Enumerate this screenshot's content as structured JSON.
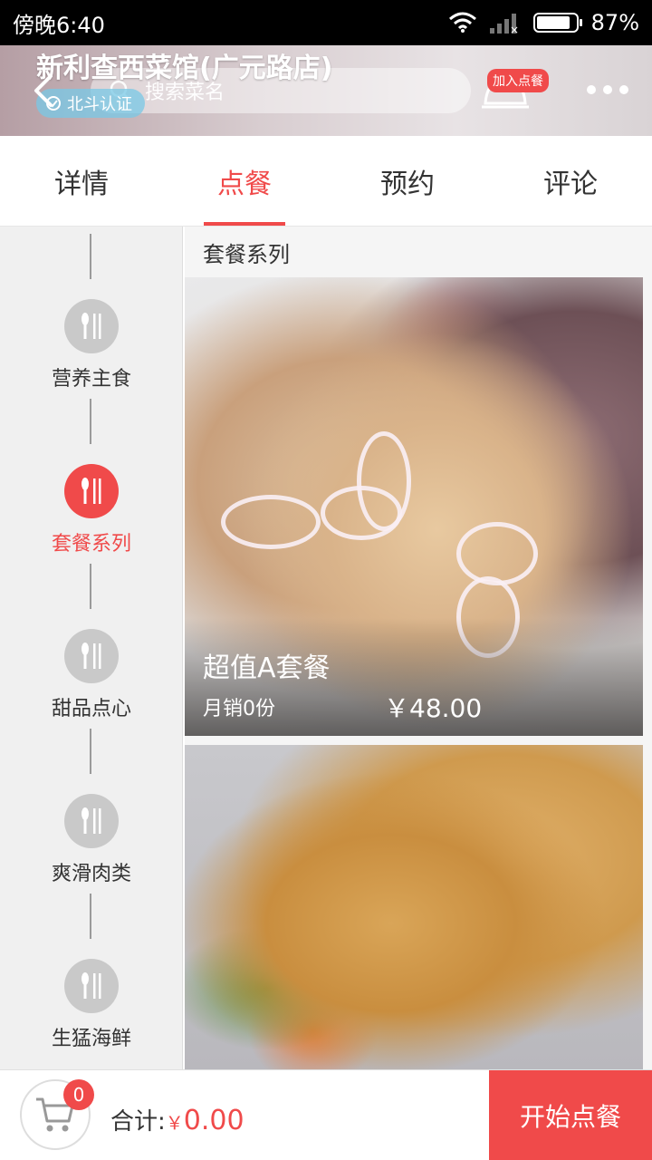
{
  "status_bar": {
    "time": "傍晚6:40",
    "battery_percent": "87%",
    "battery_level": 0.87,
    "icons": [
      "wifi-icon",
      "signal-icon",
      "battery-icon"
    ]
  },
  "header": {
    "shop_name": "新利查西菜馆(广元路店)",
    "cert_label": "北斗认证",
    "search_placeholder": "搜索菜名",
    "add_order_badge": "加入点餐",
    "icons": [
      "back-icon",
      "search-icon",
      "cart-icon",
      "more-icon"
    ]
  },
  "tabs": [
    {
      "label": "详情",
      "active": false
    },
    {
      "label": "点餐",
      "active": true
    },
    {
      "label": "预约",
      "active": false
    },
    {
      "label": "评论",
      "active": false
    }
  ],
  "sidebar": {
    "items": [
      {
        "label": "营养主食",
        "active": false,
        "icon": "cutlery-icon"
      },
      {
        "label": "套餐系列",
        "active": true,
        "icon": "cutlery-icon"
      },
      {
        "label": "甜品点心",
        "active": false,
        "icon": "cutlery-icon"
      },
      {
        "label": "爽滑肉类",
        "active": false,
        "icon": "cutlery-icon"
      },
      {
        "label": "生猛海鲜",
        "active": false,
        "icon": "cutlery-icon"
      }
    ]
  },
  "content": {
    "section_title": "套餐系列",
    "items": [
      {
        "name": "超值A套餐",
        "sales": "月销0份",
        "price": "￥48.00"
      },
      {
        "name": "",
        "sales": "",
        "price": ""
      }
    ]
  },
  "bottom_bar": {
    "cart_count": "0",
    "total_label": "合计:",
    "currency": "￥",
    "total_amount": "0.00",
    "order_button": "开始点餐"
  },
  "colors": {
    "accent": "#f04a4a",
    "sidebar_bg": "#f0f0f0",
    "inactive_icon": "#c9c9c9"
  }
}
